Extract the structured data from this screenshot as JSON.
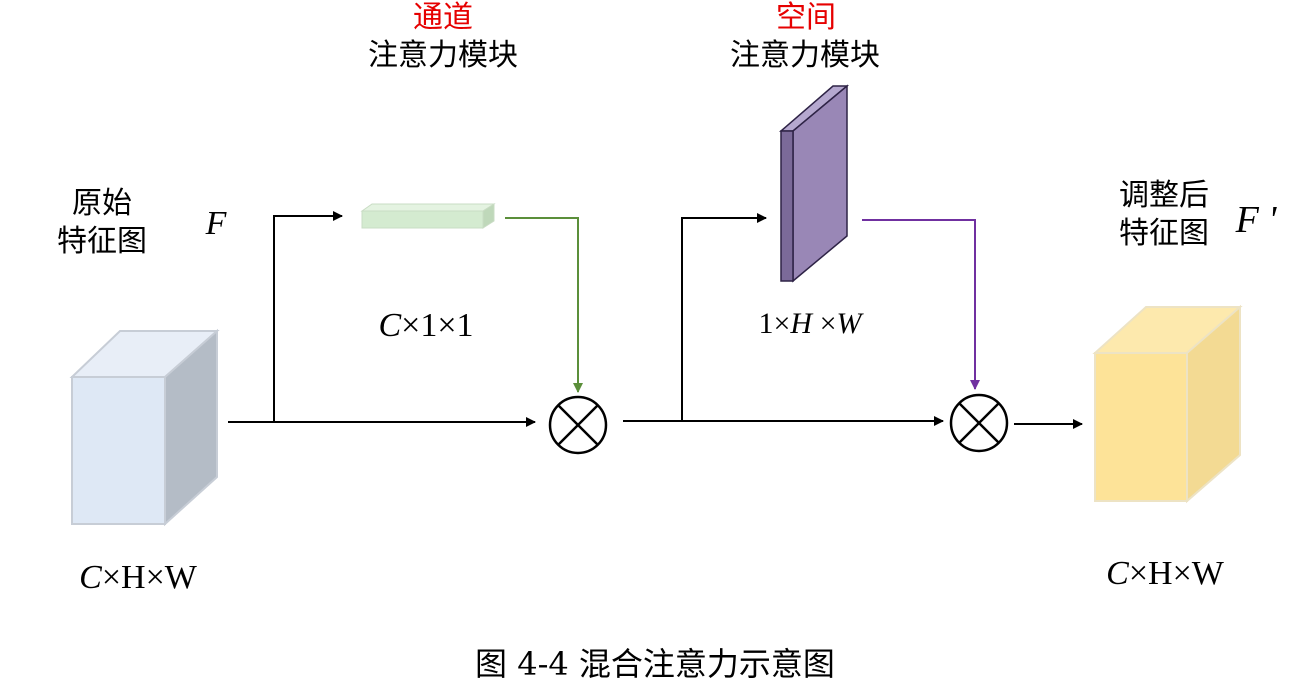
{
  "labels": {
    "channel_title": "通道",
    "channel_subtitle": "注意力模块",
    "spatial_title": "空间",
    "spatial_subtitle": "注意力模块",
    "input_line1": "原始",
    "input_line2": "特征图",
    "input_symbol": "F",
    "output_line1": "调整后",
    "output_line2": "特征图",
    "output_symbol": "F '",
    "channel_dim_c": "C",
    "channel_dim_rest": "×1×1",
    "spatial_dim_1": "1×",
    "spatial_dim_h": "H",
    "spatial_dim_x": " ×",
    "spatial_dim_w": "W",
    "input_dim_c": "C",
    "input_dim_rest": "×H×W",
    "output_dim_c": "C",
    "output_dim_rest": "×H×W",
    "caption": "图 4-4 混合注意力示意图"
  },
  "colors": {
    "input_cube_front": "#dee8f5",
    "input_cube_side": "#b4bcc6",
    "channel_block": "#d4ebd0",
    "channel_arrow": "#5b8f3a",
    "spatial_block": "#9987b6",
    "spatial_arrow": "#7030a0",
    "output_cube_front": "#fde398",
    "output_cube_side": "#f3da93",
    "title_red": "#e60000"
  }
}
